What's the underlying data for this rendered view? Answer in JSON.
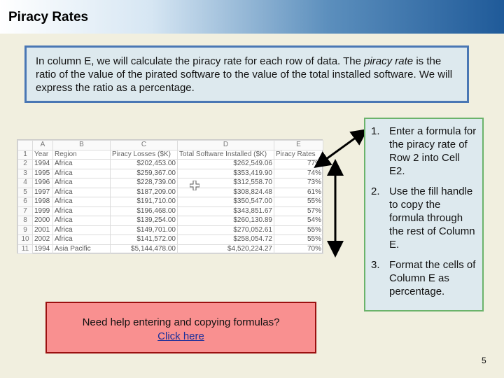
{
  "slide": {
    "title": "Piracy Rates",
    "page_number": "5"
  },
  "intro": {
    "part1": "In column E, we will calculate the piracy rate for each row of data.  The ",
    "italic1": "piracy rate",
    "part2": " is the ratio of the value of the pirated software to the value of the total installed software.  We will express the ratio as a percentage."
  },
  "spreadsheet": {
    "columns": [
      "A",
      "B",
      "C",
      "D",
      "E"
    ],
    "header_row": {
      "row_number": "1",
      "cells": [
        "Year",
        "Region",
        "Piracy Losses ($K)",
        "Total Software Installed ($K)",
        "Piracy Rates"
      ]
    },
    "rows": [
      {
        "n": "2",
        "year": "1994",
        "region": "Africa",
        "losses": "$202,453.00",
        "installed": "$262,549.06",
        "rate": "77%"
      },
      {
        "n": "3",
        "year": "1995",
        "region": "Africa",
        "losses": "$259,367.00",
        "installed": "$353,419.90",
        "rate": "74%"
      },
      {
        "n": "4",
        "year": "1996",
        "region": "Africa",
        "losses": "$228,739.00",
        "installed": "$312,558.70",
        "rate": "73%"
      },
      {
        "n": "5",
        "year": "1997",
        "region": "Africa",
        "losses": "$187,209.00",
        "installed": "$308,824.48",
        "rate": "61%"
      },
      {
        "n": "6",
        "year": "1998",
        "region": "Africa",
        "losses": "$191,710.00",
        "installed": "$350,547.00",
        "rate": "55%"
      },
      {
        "n": "7",
        "year": "1999",
        "region": "Africa",
        "losses": "$196,468.00",
        "installed": "$343,851.67",
        "rate": "57%"
      },
      {
        "n": "8",
        "year": "2000",
        "region": "Africa",
        "losses": "$139,254.00",
        "installed": "$260,130.89",
        "rate": "54%"
      },
      {
        "n": "9",
        "year": "2001",
        "region": "Africa",
        "losses": "$149,701.00",
        "installed": "$270,052.61",
        "rate": "55%"
      },
      {
        "n": "10",
        "year": "2002",
        "region": "Africa",
        "losses": "$141,572.00",
        "installed": "$258,054.72",
        "rate": "55%"
      },
      {
        "n": "11",
        "year": "1994",
        "region": "Asia Pacific",
        "losses": "$5,144,478.00",
        "installed": "$4,520,224.27",
        "rate": "70%"
      }
    ]
  },
  "steps": [
    {
      "number": "1.",
      "text": "Enter a formula for the piracy rate of Row 2 into Cell E2."
    },
    {
      "number": "2.",
      "text": "Use the fill handle to copy the formula through the rest of Column E."
    },
    {
      "number": "3.",
      "text": "Format the cells of Column E as percentage."
    }
  ],
  "help": {
    "text": "Need help entering and copying formulas?",
    "link_label": "Click here"
  },
  "colors": {
    "intro_border": "#4a77b4",
    "steps_border": "#6bb36b",
    "help_bg": "#f99090",
    "help_border": "#9b1010",
    "background": "#f1efdf"
  }
}
